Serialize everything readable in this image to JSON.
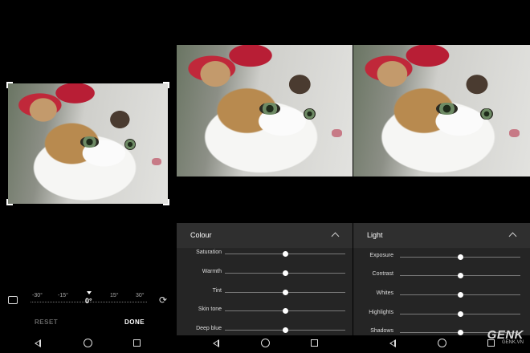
{
  "crop": {
    "ruler_labels": [
      "-30°",
      "-15°",
      "0°",
      "15°",
      "30°"
    ],
    "reset_label": "RESET",
    "done_label": "DONE"
  },
  "colour_panel": {
    "title": "Colour",
    "sliders": [
      {
        "label": "Saturation",
        "value": 0.5
      },
      {
        "label": "Warmth",
        "value": 0.5
      },
      {
        "label": "Tint",
        "value": 0.5
      },
      {
        "label": "Skin tone",
        "value": 0.5
      },
      {
        "label": "Deep blue",
        "value": 0.5
      }
    ]
  },
  "light_panel": {
    "title": "Light",
    "sliders": [
      {
        "label": "Exposure",
        "value": 0.5
      },
      {
        "label": "Contrast",
        "value": 0.5
      },
      {
        "label": "Whites",
        "value": 0.5
      },
      {
        "label": "Highlights",
        "value": 0.5
      },
      {
        "label": "Shadows",
        "value": 0.5
      }
    ]
  },
  "watermark": {
    "logo": "GENK",
    "site": "GENK.VN"
  },
  "icons": {
    "aspect": "aspect-ratio-icon",
    "rotate": "rotate-icon",
    "collapse": "chevron-up-icon",
    "nav_back": "back-triangle-icon",
    "nav_home": "home-circle-icon",
    "nav_recents": "recents-square-icon"
  }
}
